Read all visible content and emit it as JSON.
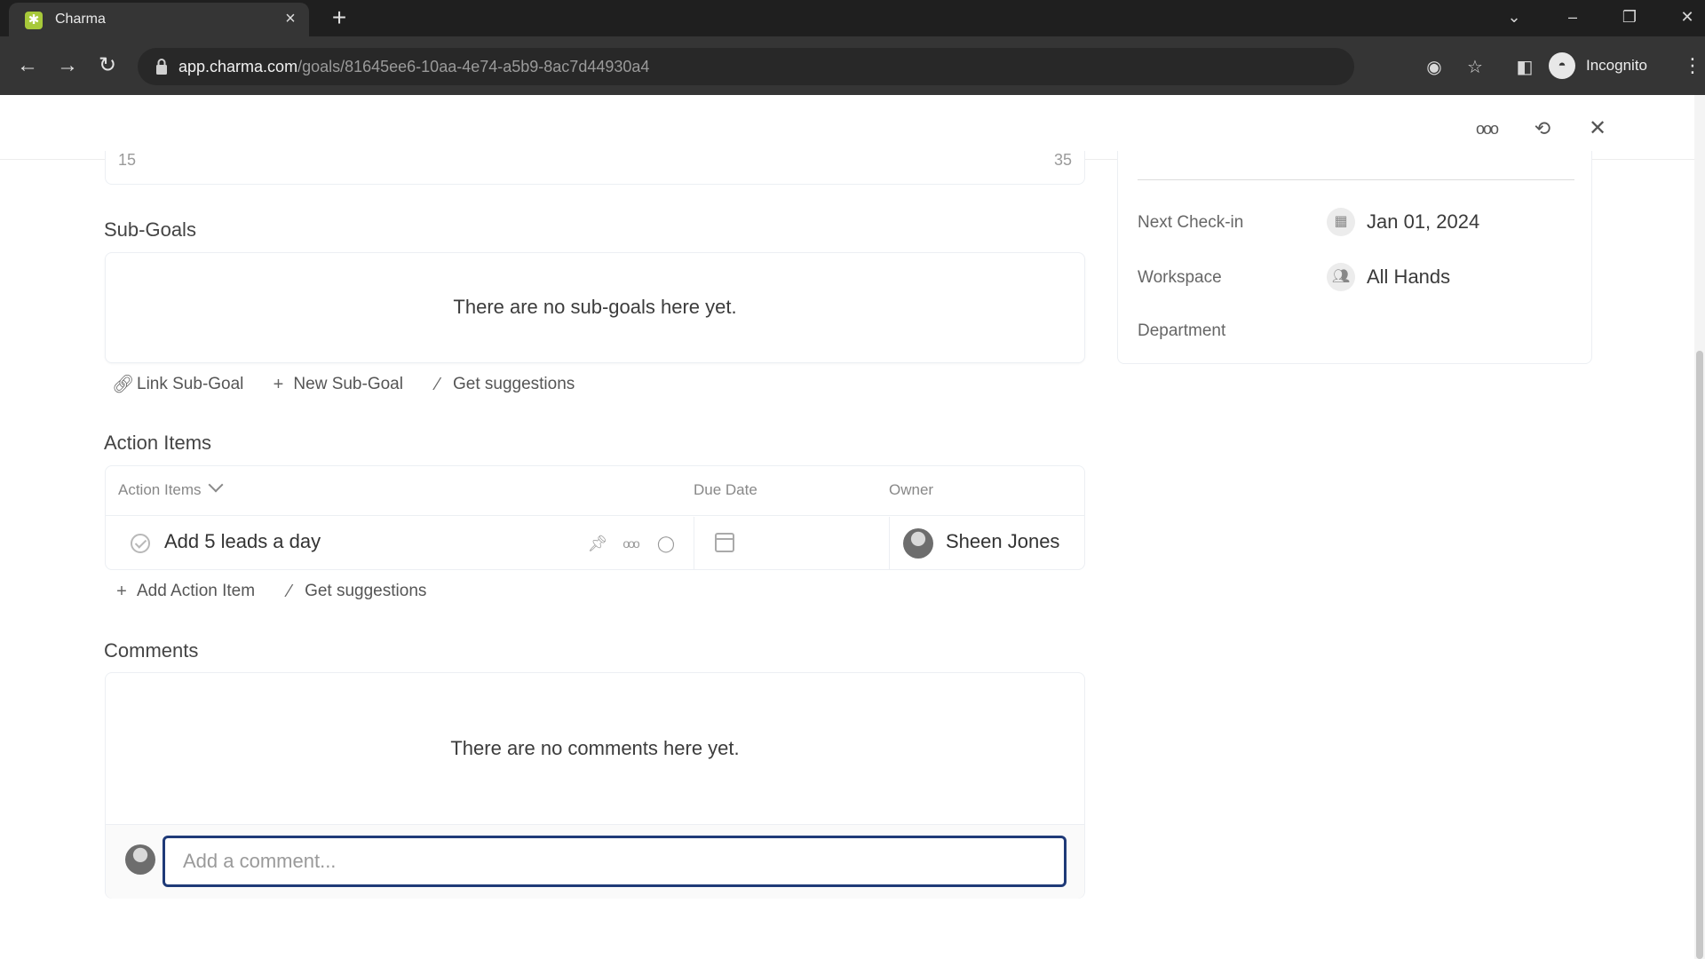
{
  "browser": {
    "tab_title": "Charma",
    "url_host": "app.charma.com",
    "url_path": "/goals/81645ee6-10aa-4e74-a5b9-8ac7d44930a4",
    "profile_label": "Incognito"
  },
  "progress": {
    "start": "15",
    "target": "35"
  },
  "subgoals": {
    "title": "Sub-Goals",
    "empty_text": "There are no sub-goals here yet.",
    "link_label": "Link Sub-Goal",
    "new_label": "New Sub-Goal",
    "suggest_label": "Get suggestions"
  },
  "action_items": {
    "title": "Action Items",
    "columns": {
      "item": "Action Items",
      "due": "Due Date",
      "owner": "Owner"
    },
    "rows": [
      {
        "title": "Add 5 leads a day",
        "due": "",
        "owner": "Sheen Jones"
      }
    ],
    "add_label": "Add Action Item",
    "suggest_label": "Get suggestions"
  },
  "comments": {
    "title": "Comments",
    "empty_text": "There are no comments here yet.",
    "placeholder": "Add a comment..."
  },
  "details": {
    "next_checkin_label": "Next Check-in",
    "next_checkin_value": "Jan 01, 2024",
    "workspace_label": "Workspace",
    "workspace_value": "All Hands",
    "department_label": "Department"
  },
  "colors": {
    "accent": "#1f3a78",
    "favicon": "#a7c93a"
  }
}
